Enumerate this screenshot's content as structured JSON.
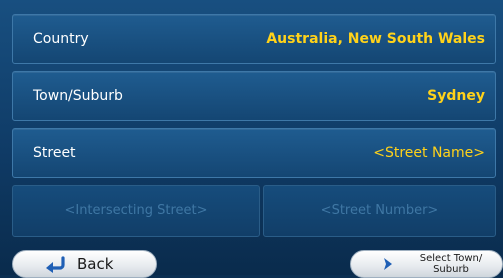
{
  "fields": {
    "country": {
      "label": "Country",
      "value": "Australia, New South Wales"
    },
    "town": {
      "label": "Town/Suburb",
      "value": "Sydney"
    },
    "street": {
      "label": "Street",
      "value": "<Street Name>"
    },
    "intersecting_placeholder": "<Intersecting Street>",
    "street_number_placeholder": "<Street Number>"
  },
  "buttons": {
    "back_label": "Back",
    "select_town_line1": "Select Town/",
    "select_town_line2": "Suburb"
  },
  "colors": {
    "background": "#0f3b66",
    "value_text": "#ffd21a",
    "label_text": "#ffffff",
    "disabled_text": "#3f77a4",
    "button_icon": "#1f5fb5"
  },
  "icons": {
    "back": "back-arrow-icon",
    "select": "chevron-right-icon"
  }
}
